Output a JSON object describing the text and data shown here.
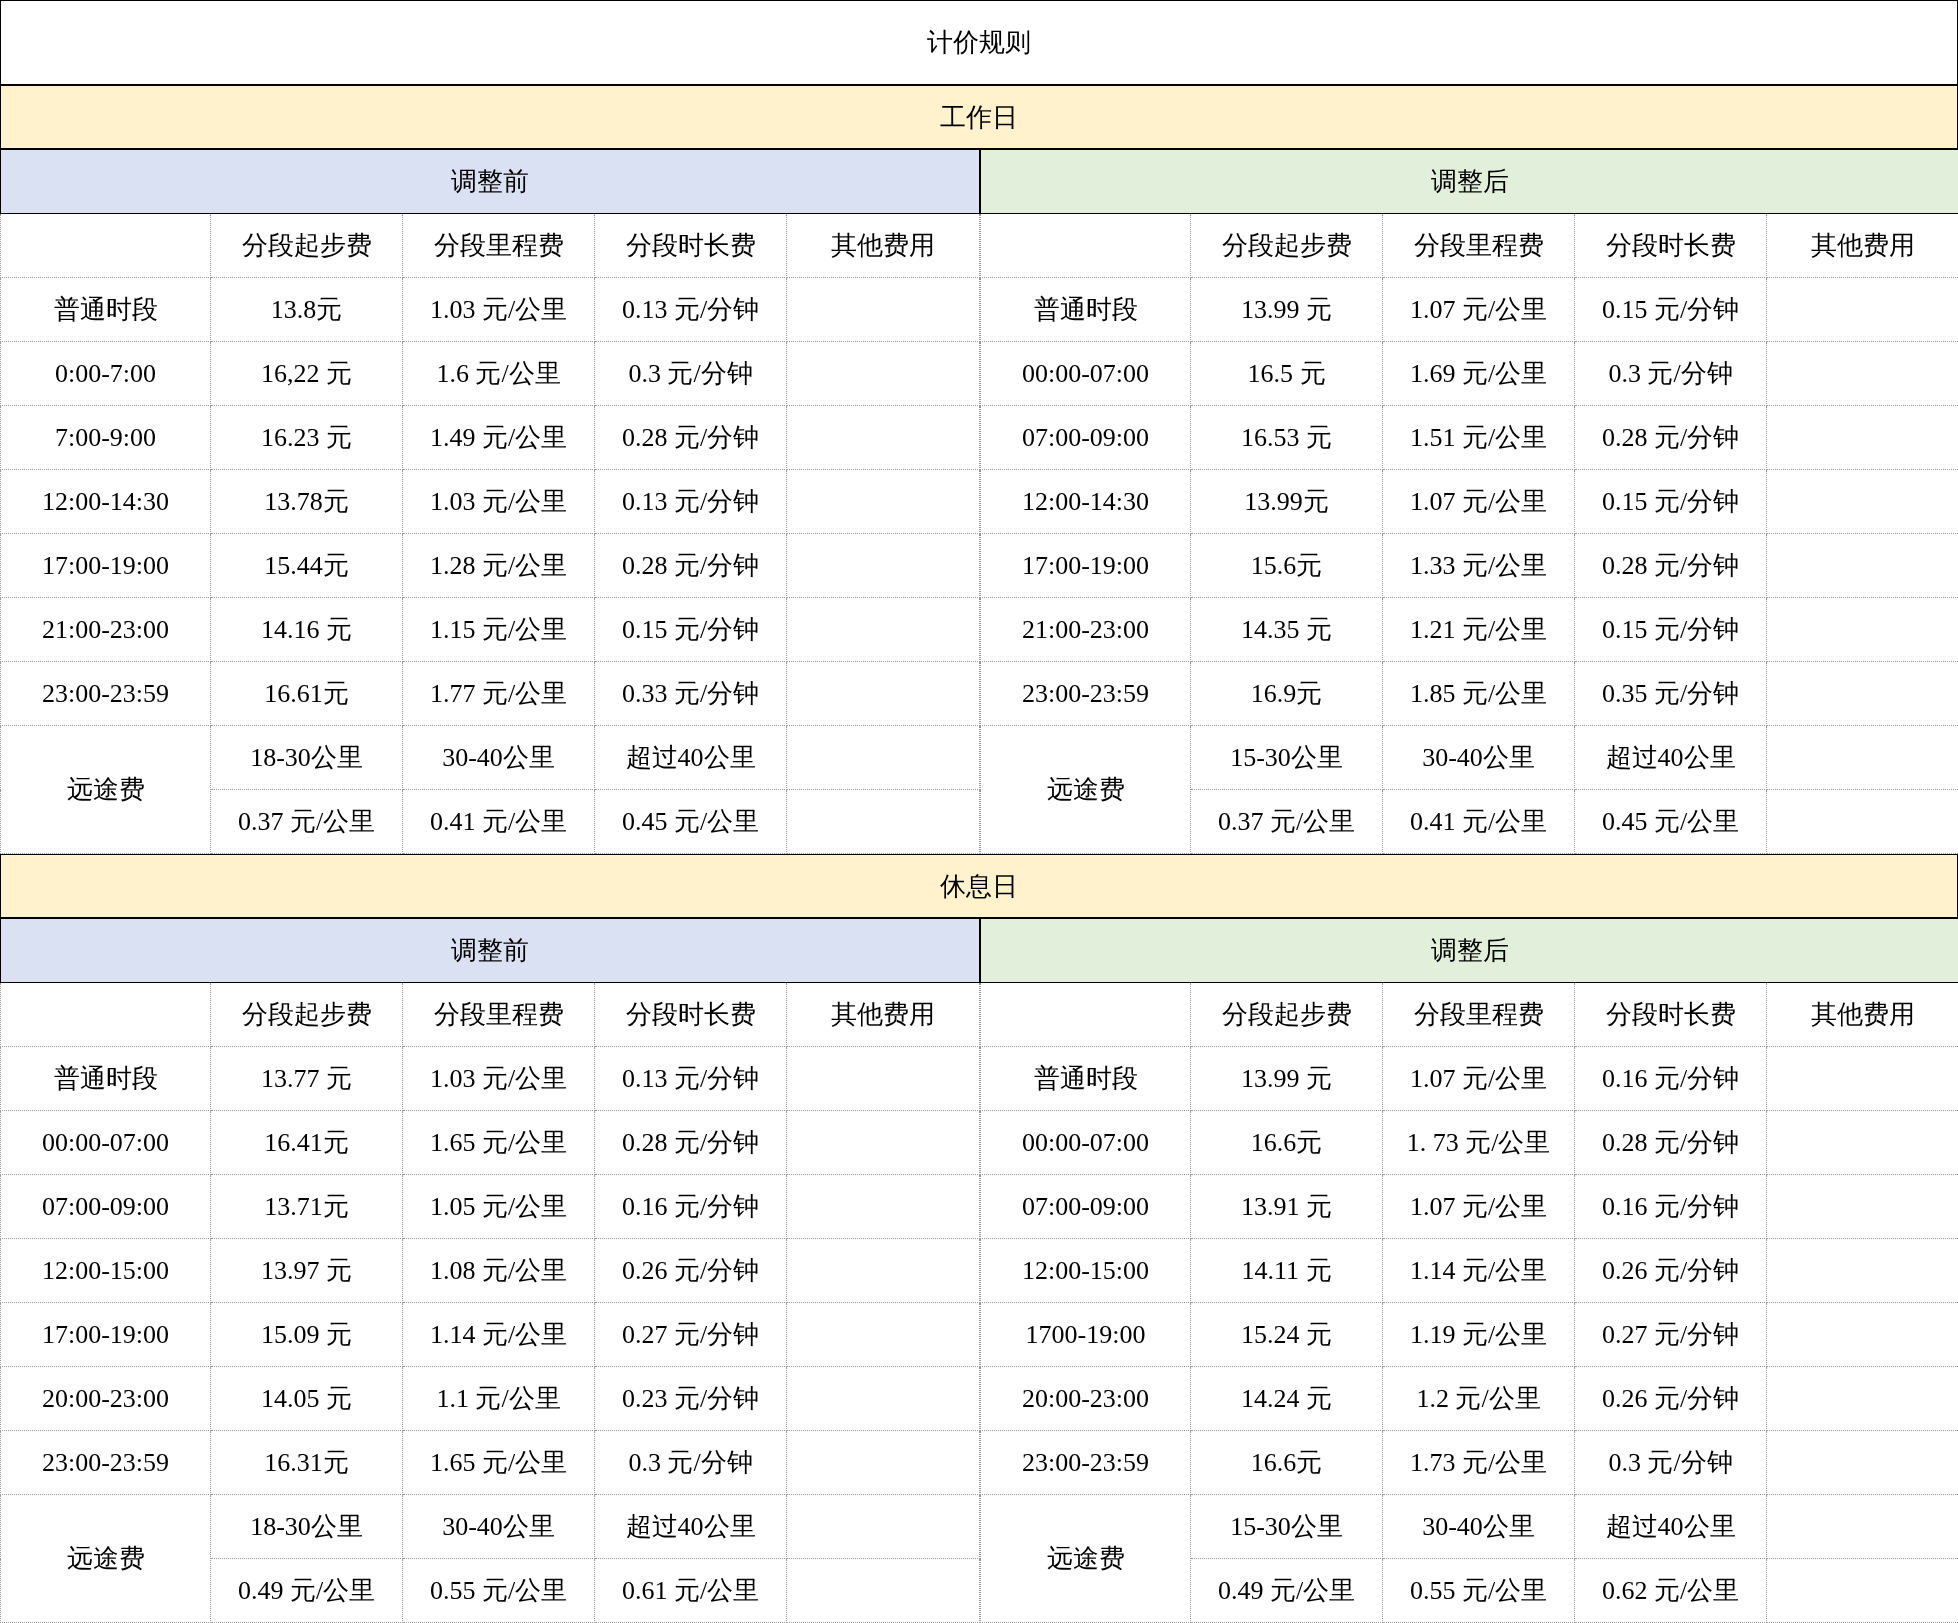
{
  "title": "计价规则",
  "sections": [
    {
      "label": "工作日",
      "blocks": [
        {
          "label": "调整前",
          "kind": "before",
          "columns": [
            "分段起步费",
            "分段里程费",
            "分段时长费",
            "其他费用"
          ],
          "rows": [
            {
              "period": "普通时段",
              "cells": [
                "13.8元",
                "1.03 元/公里",
                "0.13 元/分钟"
              ]
            },
            {
              "period": "0:00-7:00",
              "cells": [
                "16,22 元",
                "1.6 元/公里",
                "0.3 元/分钟"
              ]
            },
            {
              "period": "7:00-9:00",
              "cells": [
                "16.23 元",
                "1.49 元/公里",
                "0.28 元/分钟"
              ]
            },
            {
              "period": "12:00-14:30",
              "cells": [
                "13.78元",
                "1.03 元/公里",
                "0.13 元/分钟"
              ]
            },
            {
              "period": "17:00-19:00",
              "cells": [
                "15.44元",
                "1.28 元/公里",
                "0.28 元/分钟"
              ]
            },
            {
              "period": "21:00-23:00",
              "cells": [
                "14.16 元",
                "1.15 元/公里",
                "0.15 元/分钟"
              ]
            },
            {
              "period": "23:00-23:59",
              "cells": [
                "16.61元",
                "1.77 元/公里",
                "0.33 元/分钟"
              ]
            }
          ],
          "long_distance": {
            "label": "远途费",
            "ranges": [
              "18-30公里",
              "30-40公里",
              "超过40公里"
            ],
            "rates": [
              "0.37 元/公里",
              "0.41 元/公里",
              "0.45 元/公里"
            ]
          }
        },
        {
          "label": "调整后",
          "kind": "after",
          "columns": [
            "分段起步费",
            "分段里程费",
            "分段时长费",
            "其他费用"
          ],
          "rows": [
            {
              "period": "普通时段",
              "cells": [
                "13.99 元",
                "1.07 元/公里",
                "0.15 元/分钟"
              ]
            },
            {
              "period": "00:00-07:00",
              "cells": [
                "16.5 元",
                "1.69 元/公里",
                "0.3 元/分钟"
              ]
            },
            {
              "period": "07:00-09:00",
              "cells": [
                "16.53 元",
                "1.51 元/公里",
                "0.28 元/分钟"
              ]
            },
            {
              "period": "12:00-14:30",
              "cells": [
                "13.99元",
                "1.07 元/公里",
                "0.15 元/分钟"
              ]
            },
            {
              "period": "17:00-19:00",
              "cells": [
                "15.6元",
                "1.33 元/公里",
                "0.28 元/分钟"
              ]
            },
            {
              "period": "21:00-23:00",
              "cells": [
                "14.35 元",
                "1.21 元/公里",
                "0.15 元/分钟"
              ]
            },
            {
              "period": "23:00-23:59",
              "cells": [
                "16.9元",
                "1.85 元/公里",
                "0.35 元/分钟"
              ]
            }
          ],
          "long_distance": {
            "label": "远途费",
            "ranges": [
              "15-30公里",
              "30-40公里",
              "超过40公里"
            ],
            "rates": [
              "0.37 元/公里",
              "0.41 元/公里",
              "0.45 元/公里"
            ]
          }
        }
      ]
    },
    {
      "label": "休息日",
      "blocks": [
        {
          "label": "调整前",
          "kind": "before",
          "columns": [
            "分段起步费",
            "分段里程费",
            "分段时长费",
            "其他费用"
          ],
          "rows": [
            {
              "period": "普通时段",
              "cells": [
                "13.77 元",
                "1.03 元/公里",
                "0.13 元/分钟"
              ]
            },
            {
              "period": "00:00-07:00",
              "cells": [
                "16.41元",
                "1.65 元/公里",
                "0.28 元/分钟"
              ]
            },
            {
              "period": "07:00-09:00",
              "cells": [
                "13.71元",
                "1.05 元/公里",
                "0.16 元/分钟"
              ]
            },
            {
              "period": "12:00-15:00",
              "cells": [
                "13.97 元",
                "1.08 元/公里",
                "0.26 元/分钟"
              ]
            },
            {
              "period": "17:00-19:00",
              "cells": [
                "15.09 元",
                "1.14 元/公里",
                "0.27 元/分钟"
              ]
            },
            {
              "period": "20:00-23:00",
              "cells": [
                "14.05 元",
                "1.1 元/公里",
                "0.23 元/分钟"
              ]
            },
            {
              "period": "23:00-23:59",
              "cells": [
                "16.31元",
                "1.65 元/公里",
                "0.3 元/分钟"
              ]
            }
          ],
          "long_distance": {
            "label": "远途费",
            "ranges": [
              "18-30公里",
              "30-40公里",
              "超过40公里"
            ],
            "rates": [
              "0.49 元/公里",
              "0.55 元/公里",
              "0.61 元/公里"
            ]
          }
        },
        {
          "label": "调整后",
          "kind": "after",
          "columns": [
            "分段起步费",
            "分段里程费",
            "分段时长费",
            "其他费用"
          ],
          "rows": [
            {
              "period": "普通时段",
              "cells": [
                "13.99 元",
                "1.07 元/公里",
                "0.16 元/分钟"
              ]
            },
            {
              "period": "00:00-07:00",
              "cells": [
                "16.6元",
                "1. 73 元/公里",
                "0.28 元/分钟"
              ]
            },
            {
              "period": "07:00-09:00",
              "cells": [
                "13.91 元",
                "1.07 元/公里",
                "0.16 元/分钟"
              ]
            },
            {
              "period": "12:00-15:00",
              "cells": [
                "14.11 元",
                "1.14 元/公里",
                "0.26 元/分钟"
              ]
            },
            {
              "period": "1700-19:00",
              "cells": [
                "15.24 元",
                "1.19 元/公里",
                "0.27 元/分钟"
              ]
            },
            {
              "period": "20:00-23:00",
              "cells": [
                "14.24 元",
                "1.2 元/公里",
                "0.26 元/分钟"
              ]
            },
            {
              "period": "23:00-23:59",
              "cells": [
                "16.6元",
                "1.73 元/公里",
                "0.3 元/分钟"
              ]
            }
          ],
          "long_distance": {
            "label": "远途费",
            "ranges": [
              "15-30公里",
              "30-40公里",
              "超过40公里"
            ],
            "rates": [
              "0.49 元/公里",
              "0.55 元/公里",
              "0.62 元/公里"
            ]
          }
        }
      ]
    }
  ]
}
